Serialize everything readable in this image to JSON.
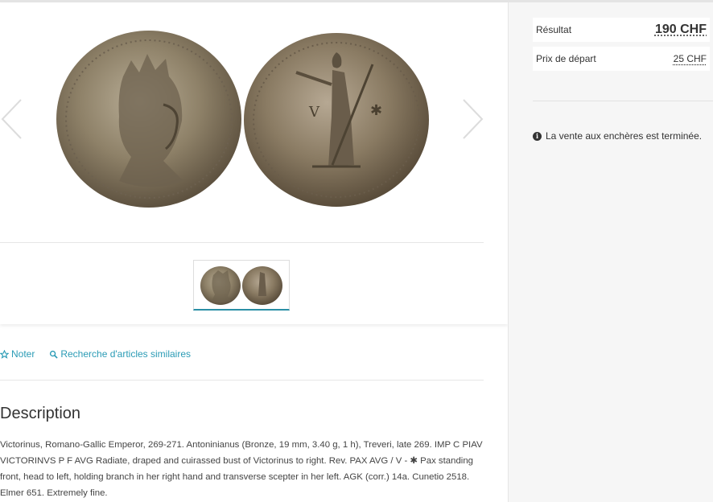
{
  "gallery": {
    "prev_icon": "chevron-left-icon",
    "next_icon": "chevron-right-icon",
    "main_image": "coin obverse and reverse",
    "thumbnail_image": "coin thumbnail"
  },
  "actions": {
    "note_icon": "star-outline-icon",
    "note_label": "Noter",
    "similar_icon": "search-icon",
    "similar_label": "Recherche d'articles similaires"
  },
  "description": {
    "title": "Description",
    "text": "Victorinus, Romano-Gallic Emperor, 269-271. Antoninianus (Bronze, 19 mm, 3.40 g, 1 h), Treveri, late 269. IMP C PIAV VICTORINVS P F AVG Radiate, draped and cuirassed bust of Victorinus to right. Rev. PAX AVG / V - ✱ Pax standing front, head to left, holding branch in her right hand and transverse scepter in her left. AGK (corr.) 14a. Cunetio 2518. Elmer 651. Extremely fine."
  },
  "auction": {
    "result_label": "Résultat",
    "result_value": "190 CHF",
    "start_label": "Prix de départ",
    "start_value": "25 CHF",
    "status_icon": "info-circle-icon",
    "status_text": "La vente aux enchères est terminée."
  },
  "colors": {
    "accent": "#2a9bb5",
    "thumb_underline": "#2a8fa6",
    "sidebar_bg": "#f6f6f6"
  }
}
